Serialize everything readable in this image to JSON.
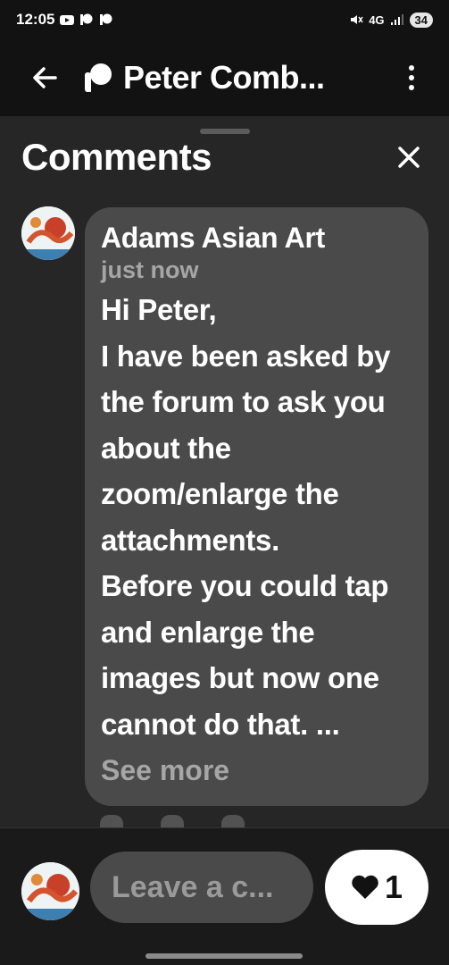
{
  "status_bar": {
    "time": "12:05",
    "network": "4G",
    "battery": "34",
    "icons": [
      "youtube-icon",
      "patreon-icon",
      "patreon-icon",
      "mute-icon",
      "signal-icon"
    ]
  },
  "app_bar": {
    "title": "Peter Comb...",
    "icons": [
      "back-arrow-icon",
      "patreon-logo-icon",
      "more-vertical-icon"
    ]
  },
  "comments_sheet": {
    "title": "Comments",
    "comment": {
      "author": "Adams Asian Art",
      "time": "just now",
      "text": "Hi Peter,\nI have been asked by the forum to ask you about the zoom/enlarge the attachments.\nBefore you could tap and enlarge the images but now one cannot do that. ...",
      "see_more_label": "See more"
    }
  },
  "bottom_bar": {
    "input_placeholder": "Leave a c...",
    "like_count": "1"
  },
  "colors": {
    "background": "#1a1a1a",
    "sheet": "#262626",
    "bubble": "#4a4a4a",
    "muted_text": "#a6a6a6",
    "like_button": "#ffffff"
  }
}
